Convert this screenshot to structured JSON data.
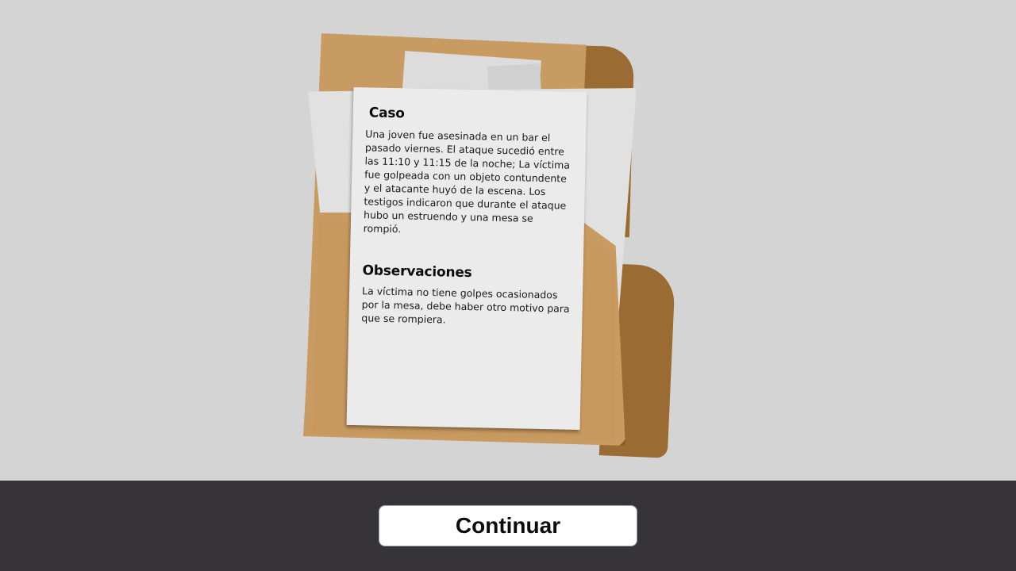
{
  "case_file": {
    "case_title": "Caso",
    "case_text": "Una joven fue asesinada en un bar el pasado viernes. El ataque sucedió entre las 11:10 y 11:15 de la noche; La víctima fue golpeada con un objeto contundente y el atacante huyó de la escena. Los testigos indicaron que durante el ataque hubo un estruendo y una mesa se rompió.",
    "observations_title": "Observaciones",
    "observations_text": "La víctima no tiene golpes ocasionados por la mesa, debe haber otro motivo para que se rompiera."
  },
  "footer": {
    "continue_label": "Continuar"
  },
  "colors": {
    "background": "#d4d4d4",
    "folder_light": "#c89b62",
    "folder_dark": "#9a6b32",
    "paper": "#ebebeb",
    "bottom_bar": "#363436",
    "button_bg": "#ffffff"
  }
}
